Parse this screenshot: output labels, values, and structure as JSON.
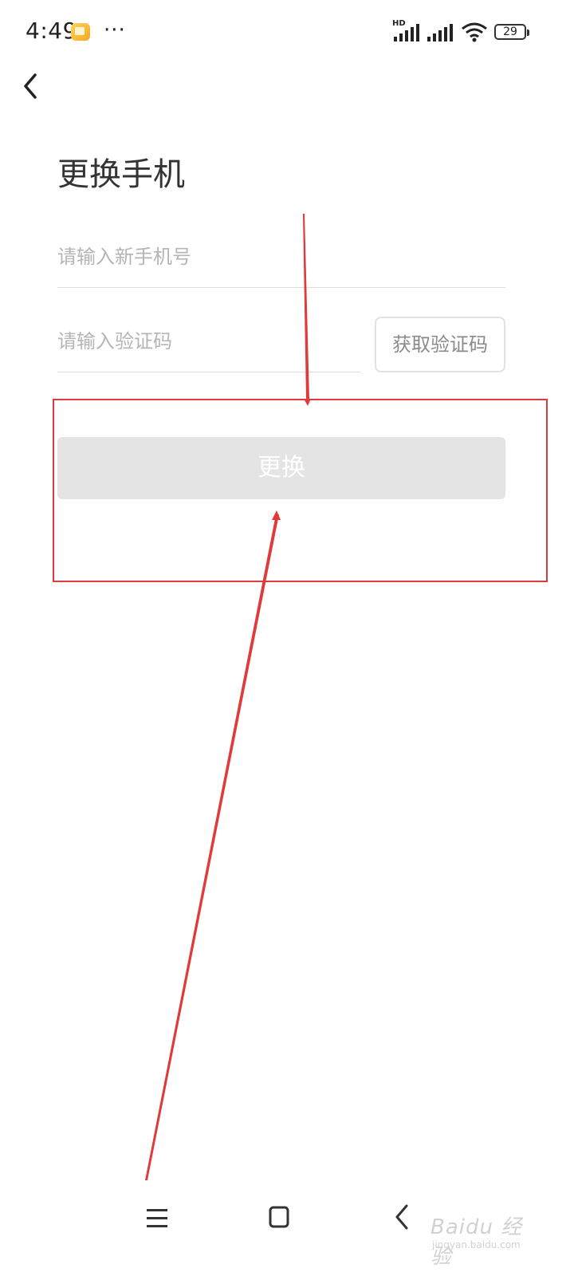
{
  "status_bar": {
    "time": "4:49",
    "more": "···",
    "hd": "HD",
    "battery": "29"
  },
  "page": {
    "title": "更换手机"
  },
  "form": {
    "phone_placeholder": "请输入新手机号",
    "code_placeholder": "请输入验证码",
    "get_code_label": "获取验证码",
    "submit_label": "更换"
  },
  "watermark": {
    "text": "Baidu 经验",
    "sub": "jingyan.baidu.com"
  },
  "icons": {
    "back": "chevron-left-icon",
    "nav_menu": "menu-icon",
    "nav_home": "home-square-icon",
    "nav_back": "chevron-left-icon"
  },
  "colors": {
    "annotation": "#e03a3a",
    "button_disabled": "#e4e4e4",
    "placeholder": "#b5b5b5"
  }
}
